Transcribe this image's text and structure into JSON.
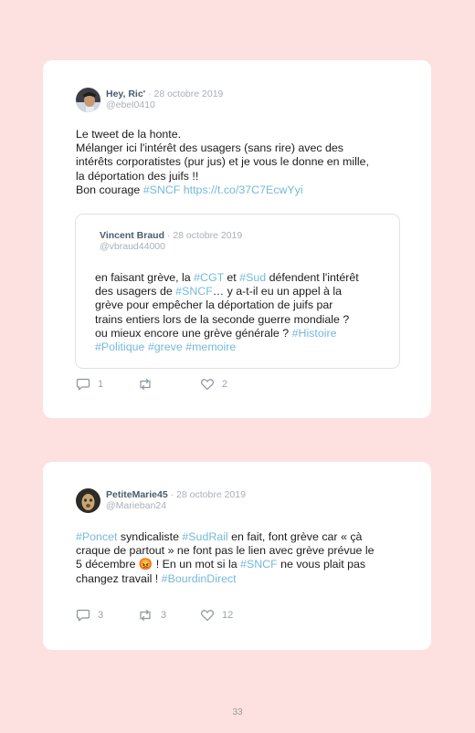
{
  "tweet1": {
    "username": "Hey, Ric'",
    "date": "· 28 octobre 2019",
    "handle": "@ebel0410",
    "line1": "Le tweet de la honte.",
    "line2": "Mélanger ici l'intérêt des usagers (sans rire) avec des",
    "line3": "intérêts corporatistes (pur jus) et je vous le donne en mille,",
    "line4": "la déportation des juifs !!",
    "line5_text": "Bon courage ",
    "line5_tag": "#SNCF",
    "line5_link": " https://t.co/37C7EcwYyi",
    "quote": {
      "username": "Vincent Braud",
      "date": "· 28 octobre 2019",
      "handle": "@vbraud44000",
      "p1": "en faisant grève, la ",
      "tag_cgt": "#CGT",
      "p2": " et ",
      "tag_sud": "#Sud",
      "p3": " défendent l'intérêt",
      "p4": "des usagers de ",
      "tag_sncf": "#SNCF",
      "p5": "… y a-t-il eu un appel à la",
      "p6": "grève pour empêcher la déportation de juifs par",
      "p7": "trains entiers lors de la seconde guerre mondiale ?",
      "p8": "ou mieux encore une grève générale ? ",
      "tag_histoire": "#Histoire",
      "tag_politique": "#Politique",
      "tag_greve": "#greve",
      "tag_memoire": "#memoire"
    },
    "replies": "1",
    "retweets": "",
    "likes": "2"
  },
  "tweet2": {
    "username": "PetiteMarie45",
    "date": "· 28 octobre 2019",
    "handle": "@Marieban24",
    "tag_poncet": "#Poncet",
    "t1": " syndicaliste ",
    "tag_sudrail": "#SudRail",
    "t2": " en fait, font grève car « çà",
    "t3": "craque de partout » ne font pas le lien avec grève prévue le",
    "t4": "5 décembre ",
    "emoji": "😡",
    "t5": " ! En un mot si la ",
    "tag_sncf": "#SNCF",
    "t6": " ne vous plait pas",
    "t7": "changez travail ! ",
    "tag_bourdin": "#BourdinDirect",
    "replies": "3",
    "retweets": "3",
    "likes": "12"
  },
  "page_number": "33",
  "colors": {
    "background": "#fde0e0",
    "card": "#ffffff",
    "hashtag": "#74b9da",
    "username": "#4a5c6d",
    "muted": "#a8b0b8"
  },
  "icons": [
    "reply-icon",
    "retweet-icon",
    "like-icon"
  ]
}
